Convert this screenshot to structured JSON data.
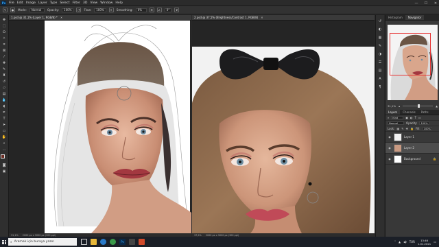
{
  "menubar": {
    "app_icon": "Ps",
    "items": [
      "File",
      "Edit",
      "Image",
      "Layer",
      "Type",
      "Select",
      "Filter",
      "3D",
      "View",
      "Window",
      "Help"
    ],
    "window_controls": [
      "—",
      "☐",
      "✕"
    ]
  },
  "options": {
    "mode_label": "Mode:",
    "mode_value": "Normal",
    "opacity_label": "Opacity:",
    "opacity_value": "100%",
    "flow_label": "Flow:",
    "flow_value": "100%",
    "smoothing_label": "Smoothing:",
    "smoothing_value": "0%",
    "angle_value": "0°"
  },
  "documents": {
    "left_tab": "1.psd @ 31,1% (Layer 1, RGB/8) *",
    "right_tab": "2.psd @ 37,5% (Brightness/Contrast 1, RGB/8)",
    "left_status": "31,1%",
    "left_status_dims": "2000 px x 3000 px (300 ppi)",
    "right_status": "37,5%",
    "right_status_dims": "2000 px x 3000 px (300 ppi)"
  },
  "panels": {
    "top_tabs": [
      "Histogram",
      "Navigator"
    ],
    "nav_zoom": "31,1%",
    "layer_tabs": [
      "Layers",
      "Channels",
      "Paths"
    ],
    "kind_label": "Kind",
    "blend_mode": "Normal",
    "opacity_label": "Opacity:",
    "opacity_value": "100%",
    "lock_label": "Lock:",
    "fill_label": "Fill:",
    "fill_value": "100%",
    "layers": [
      {
        "name": "Layer 1",
        "selected": false
      },
      {
        "name": "Layer 2",
        "selected": true
      },
      {
        "name": "Background",
        "selected": false
      }
    ]
  },
  "taskbar": {
    "search_placeholder": "Aramak için buraya yazın",
    "time": "13:46",
    "date": "1.01.2021",
    "lang": "TUR"
  },
  "colors": {
    "foreground": "#6b2b22",
    "background": "#ffffff",
    "accent": "#31a8ff"
  }
}
